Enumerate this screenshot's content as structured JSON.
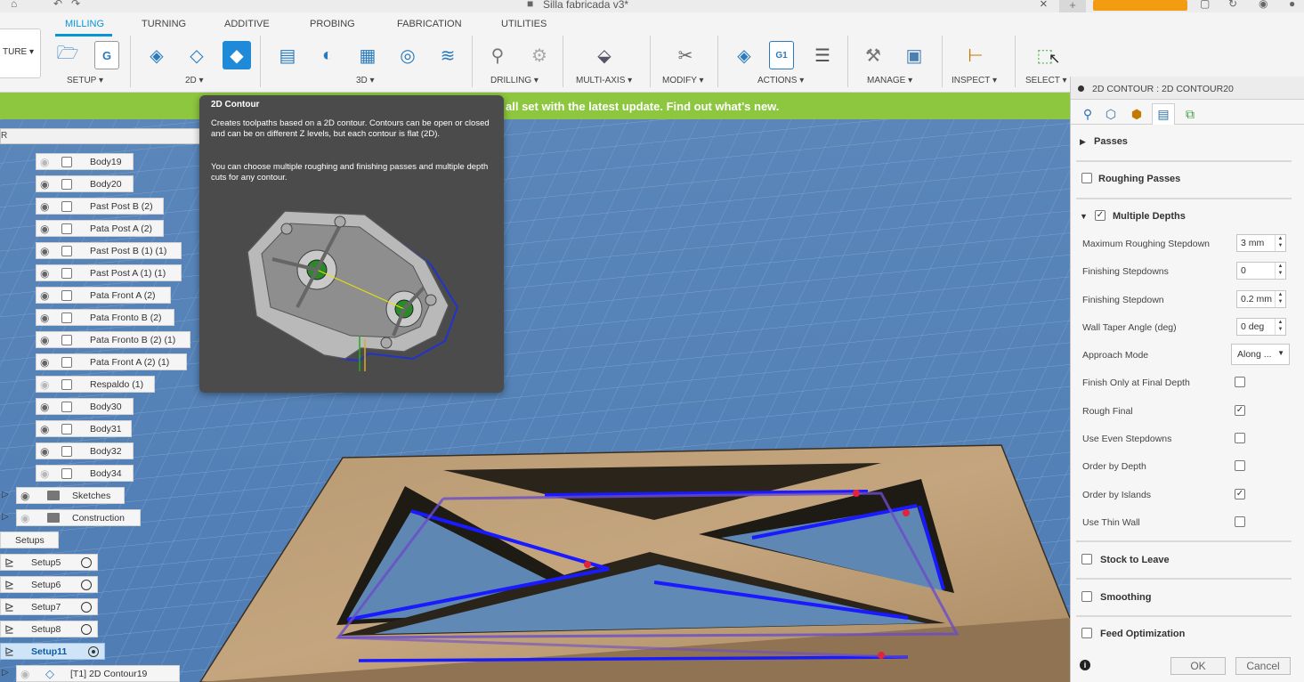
{
  "titlebar": {
    "document_title": "Silla fabricada v3*"
  },
  "ribbon": {
    "workspace_label": "TURE ▾",
    "tabs": [
      "MILLING",
      "TURNING",
      "ADDITIVE",
      "PROBING",
      "FABRICATION",
      "UTILITIES"
    ],
    "active_tab": "MILLING",
    "groups": [
      "SETUP ▾",
      "2D ▾",
      "3D ▾",
      "DRILLING ▾",
      "MULTI-AXIS ▾",
      "MODIFY ▾",
      "ACTIONS ▾",
      "MANAGE ▾",
      "INSPECT ▾",
      "SELECT ▾"
    ]
  },
  "banner": {
    "text": "all set with the latest update. Find out what's new."
  },
  "browser": {
    "header": "R",
    "bodies": [
      {
        "label": "Body19",
        "visible": false
      },
      {
        "label": "Body20",
        "visible": true
      },
      {
        "label": "Past Post B (2)",
        "visible": true
      },
      {
        "label": "Pata Post A (2)",
        "visible": true
      },
      {
        "label": "Past Post B (1) (1)",
        "visible": true
      },
      {
        "label": "Past Post A (1) (1)",
        "visible": true
      },
      {
        "label": "Pata Front A (2)",
        "visible": true
      },
      {
        "label": "Pata Fronto B (2)",
        "visible": true
      },
      {
        "label": "Pata Fronto B (2) (1)",
        "visible": true
      },
      {
        "label": "Pata Front A (2) (1)",
        "visible": true
      },
      {
        "label": "Respaldo (1)",
        "visible": false
      },
      {
        "label": "Body30",
        "visible": true
      },
      {
        "label": "Body31",
        "visible": true
      },
      {
        "label": "Body32",
        "visible": true
      },
      {
        "label": "Body34",
        "visible": false
      }
    ],
    "folders": [
      "Sketches",
      "Construction"
    ],
    "setups_label": "Setups",
    "setups": [
      "Setup5",
      "Setup6",
      "Setup7",
      "Setup8",
      "Setup11"
    ],
    "selected_setup": "Setup11",
    "operation": "[T1] 2D Contour19"
  },
  "tooltip": {
    "title": "2D Contour",
    "p1": "Creates toolpaths based on a 2D contour. Contours can be open or closed and can be on different Z levels, but each contour is flat (2D).",
    "p2": "You can choose multiple roughing and finishing passes and multiple depth cuts for any contour."
  },
  "panel": {
    "title": "2D CONTOUR : 2D CONTOUR20",
    "sections": {
      "passes": "Passes",
      "roughing_passes": "Roughing Passes",
      "multiple_depths": "Multiple Depths",
      "stock_to_leave": "Stock to Leave",
      "smoothing": "Smoothing",
      "feed_optimization": "Feed Optimization"
    },
    "fields": [
      {
        "label": "Maximum Roughing Stepdown",
        "value": "3 mm"
      },
      {
        "label": "Finishing Stepdowns",
        "value": "0"
      },
      {
        "label": "Finishing Stepdown",
        "value": "0.2 mm"
      },
      {
        "label": "Wall Taper Angle (deg)",
        "value": "0 deg"
      }
    ],
    "approach_mode": {
      "label": "Approach Mode",
      "value": "Along ..."
    },
    "checkboxes": [
      {
        "label": "Finish Only at Final Depth",
        "checked": false
      },
      {
        "label": "Rough Final",
        "checked": true
      },
      {
        "label": "Use Even Stepdowns",
        "checked": false
      },
      {
        "label": "Order by Depth",
        "checked": false
      },
      {
        "label": "Order by Islands",
        "checked": true
      },
      {
        "label": "Use Thin Wall",
        "checked": false
      }
    ],
    "ok_label": "OK",
    "cancel_label": "Cancel"
  },
  "colors": {
    "accent": "#0696d7",
    "banner": "#8dc63f",
    "toolpath": "#1a1aff",
    "grid_bg": "#5b86b8"
  }
}
